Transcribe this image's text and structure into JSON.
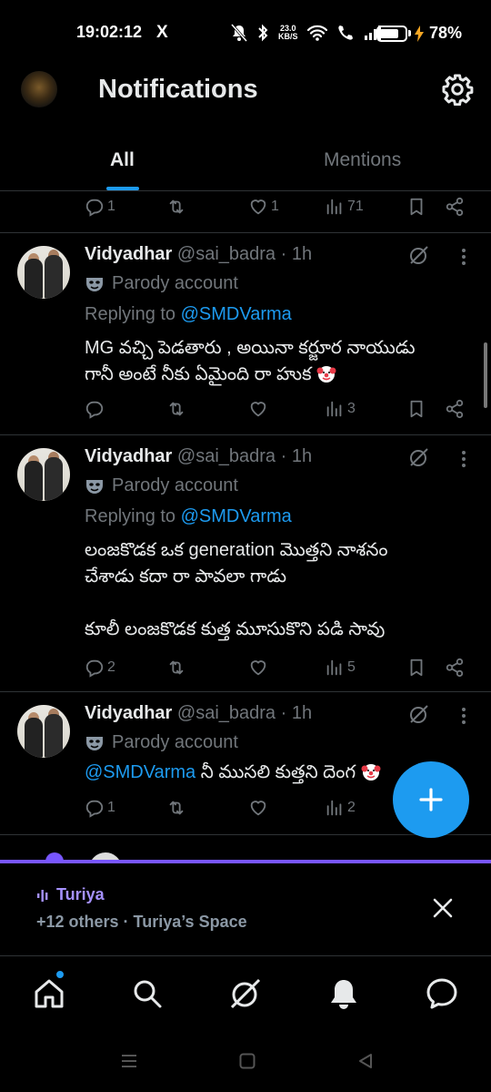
{
  "status_bar": {
    "time": "19:02:12",
    "app_icon": "X",
    "net_speed_value": "23.0",
    "net_speed_unit": "KB/S",
    "battery": "78%",
    "battery_level": 0.78
  },
  "header": {
    "title": "Notifications",
    "settings_icon": "gear-icon"
  },
  "tabs": [
    {
      "label": "All",
      "active": true
    },
    {
      "label": "Mentions",
      "active": false
    }
  ],
  "partial_tweet_actions": {
    "replies": "1",
    "reposts": "",
    "likes": "1",
    "views": "71"
  },
  "tweets": [
    {
      "name": "Vidyadhar",
      "handle": "@sai_badra",
      "time": "· 1h",
      "parody": "Parody account",
      "reply_prefix": "Replying to",
      "reply_to": "@SMDVarma",
      "text_line1": "MG వచ్చి పెడతారు , అయినా కర్జూర నాయుడు",
      "text_line2": "గానీ అంటే నీకు ఏమైంది రా హుక",
      "actions": {
        "replies": "",
        "reposts": "",
        "likes": "",
        "views": "3"
      }
    },
    {
      "name": "Vidyadhar",
      "handle": "@sai_badra",
      "time": "· 1h",
      "parody": "Parody account",
      "reply_prefix": "Replying to",
      "reply_to": "@SMDVarma",
      "text_line1": "లంజకొడక ఒక generation మొత్తని నాశనం",
      "text_line2": "చేశాడు కదా రా పావలా గాడు",
      "text_line3": "కూలీ లంజకొడక కుత్త మూసుకొని పడి సావు",
      "actions": {
        "replies": "2",
        "reposts": "",
        "likes": "",
        "views": "5"
      }
    },
    {
      "name": "Vidyadhar",
      "handle": "@sai_badra",
      "time": "· 1h",
      "parody": "Parody account",
      "mention": "@SMDVarma",
      "text_line1": " నీ ముసలి కుత్తని దెంగ",
      "actions": {
        "replies": "1",
        "reposts": "",
        "likes": "",
        "views": "2"
      }
    }
  ],
  "space": {
    "host": "Turiya",
    "subtitle": "+12 others · Turiya’s Space"
  },
  "bottom_nav": [
    "home-icon",
    "search-icon",
    "grok-icon",
    "notifications-icon",
    "messages-icon"
  ],
  "colors": {
    "accent": "#1d9bf0",
    "space": "#7856ff",
    "muted": "#71767b",
    "background": "#000000"
  }
}
